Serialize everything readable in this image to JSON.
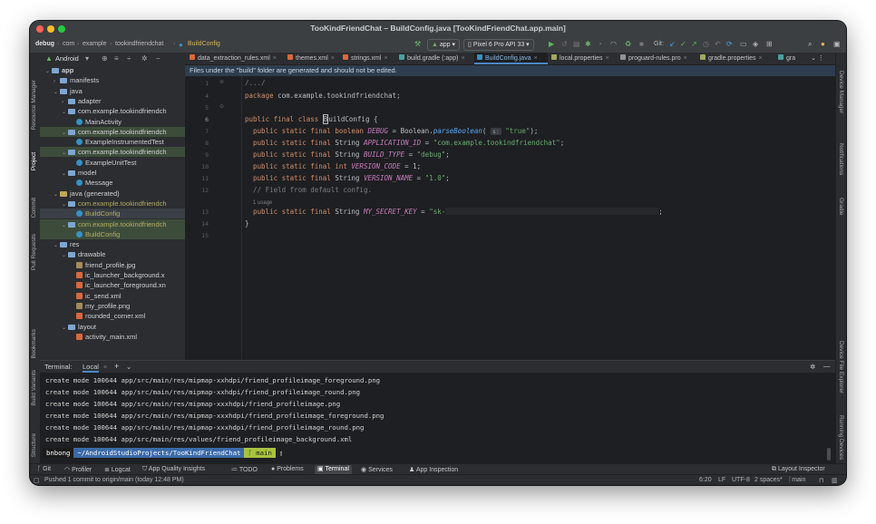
{
  "window": {
    "title": "TooKindFriendChat – BuildConfig.java [TooKindFriendChat.app.main]"
  },
  "toolbar": {
    "breadcrumb": [
      "debug",
      "com",
      "example",
      "tookindfriendchat",
      "BuildConfig"
    ],
    "run_config": "app",
    "device": "Pixel 6 Pro API 33",
    "git_label": "Git:"
  },
  "left_tools": [
    "Resource Manager",
    "Project",
    "Commit",
    "Pull Requests",
    "Bookmarks",
    "Build Variants",
    "Structure"
  ],
  "right_tools": [
    "Device Manager",
    "Notifications",
    "Gradle",
    "Device File Explorer",
    "Running Devices"
  ],
  "project": {
    "view": "Android",
    "tree": [
      {
        "label": "app",
        "level": 0,
        "kind": "module",
        "expanded": true
      },
      {
        "label": "manifests",
        "level": 1,
        "kind": "folder",
        "expanded": false
      },
      {
        "label": "java",
        "level": 1,
        "kind": "folder",
        "expanded": true
      },
      {
        "label": "adapter",
        "level": 2,
        "kind": "folder",
        "expanded": false
      },
      {
        "label": "com.example.tookindfriendch",
        "level": 2,
        "kind": "folder",
        "expanded": true
      },
      {
        "label": "MainActivity",
        "level": 3,
        "kind": "class"
      },
      {
        "label": "com.example.tookindfriendch",
        "level": 2,
        "kind": "folder",
        "expanded": true,
        "highlight": true
      },
      {
        "label": "ExampleInstrumentedTest",
        "level": 3,
        "kind": "class"
      },
      {
        "label": "com.example.tookindfriendch",
        "level": 2,
        "kind": "folder",
        "expanded": true,
        "highlight": true
      },
      {
        "label": "ExampleUnitTest",
        "level": 3,
        "kind": "class"
      },
      {
        "label": "model",
        "level": 2,
        "kind": "folder",
        "expanded": true
      },
      {
        "label": "Message",
        "level": 3,
        "kind": "class"
      },
      {
        "label": "java (generated)",
        "level": 1,
        "kind": "genfolder",
        "expanded": true
      },
      {
        "label": "com.example.tookindfriendch",
        "level": 2,
        "kind": "folder",
        "expanded": true,
        "generated": true
      },
      {
        "label": "BuildConfig",
        "level": 3,
        "kind": "class",
        "generated": true,
        "selected": true
      },
      {
        "label": "com.example.tookindfriendch",
        "level": 2,
        "kind": "folder",
        "expanded": true,
        "generated": true,
        "highlight": true
      },
      {
        "label": "BuildConfig",
        "level": 3,
        "kind": "class",
        "generated": true,
        "highlight": true
      },
      {
        "label": "res",
        "level": 1,
        "kind": "folder",
        "expanded": true
      },
      {
        "label": "drawable",
        "level": 2,
        "kind": "folder",
        "expanded": true
      },
      {
        "label": "friend_profile.jpg",
        "level": 3,
        "kind": "img"
      },
      {
        "label": "ic_launcher_background.x",
        "level": 3,
        "kind": "xml"
      },
      {
        "label": "ic_launcher_foreground.xn",
        "level": 3,
        "kind": "xml"
      },
      {
        "label": "ic_send.xml",
        "level": 3,
        "kind": "xml"
      },
      {
        "label": "my_profile.png",
        "level": 3,
        "kind": "img"
      },
      {
        "label": "rounded_corner.xml",
        "level": 3,
        "kind": "xml"
      },
      {
        "label": "layout",
        "level": 2,
        "kind": "folder",
        "expanded": true
      },
      {
        "label": "activity_main.xml",
        "level": 3,
        "kind": "xml"
      }
    ]
  },
  "editor": {
    "tabs": [
      {
        "label": "data_extraction_rules.xml",
        "color": "#d9683d"
      },
      {
        "label": "themes.xml",
        "color": "#d9683d"
      },
      {
        "label": "strings.xml",
        "color": "#d9683d"
      },
      {
        "label": "build.gradle (:app)",
        "color": "#4aa0a0"
      },
      {
        "label": "BuildConfig.java",
        "color": "#3592c4",
        "active": true
      },
      {
        "label": "local.properties",
        "color": "#a1a860"
      },
      {
        "label": "proguard-rules.pro",
        "color": "#8f9498"
      },
      {
        "label": "gradle.properties",
        "color": "#a1a860"
      },
      {
        "label": "gra",
        "color": "#4aa0a0"
      }
    ],
    "banner": "Files under the \"build\" folder are generated and should not be edited.",
    "line_numbers": [
      "1",
      "4",
      "5",
      "6",
      "7",
      "8",
      "9",
      "10",
      "11",
      "12",
      "13",
      "14",
      "15"
    ],
    "lines": {
      "l1": "/.../",
      "l4_kw": "package",
      "l4_rest": " com.example.tookindfriendchat;",
      "l6_kw": "public final class",
      "l6_cursor": "B",
      "l6_rest": "uildConfig {",
      "l7_kw": "public static final boolean",
      "l7_const": "DEBUG",
      "l7_mid": " = Boolean.",
      "l7_fn": "parseBoolean",
      "l7_paren": "( ",
      "l7_param": "s:",
      "l7_str": " \"true\"",
      "l7_end": ");",
      "l8_kw": "public static final",
      "l8_type": " String ",
      "l8_const": "APPLICATION_ID",
      "l8_eq": " = ",
      "l8_str": "\"com.example.tookindfriendchat\"",
      "l8_end": ";",
      "l9_kw": "public static final",
      "l9_type": " String ",
      "l9_const": "BUILD_TYPE",
      "l9_eq": " = ",
      "l9_str": "\"debug\"",
      "l9_end": ";",
      "l10_kw": "public static final int",
      "l10_const": " VERSION_CODE",
      "l10_end": " = 1;",
      "l11_kw": "public static final",
      "l11_type": " String ",
      "l11_const": "VERSION_NAME",
      "l11_eq": " = ",
      "l11_str": "\"1.0\"",
      "l11_end": ";",
      "l12": "// Field from default config.",
      "usage": "1 usage",
      "l13_kw": "public static final",
      "l13_type": " String ",
      "l13_const": "MY_SECRET_KEY",
      "l13_eq": " = ",
      "l13_str": "\"sk-",
      "l13_end": ";",
      "l14": "}"
    }
  },
  "terminal": {
    "title": "Terminal:",
    "tab": "Local",
    "lines": [
      "create mode 100644 app/src/main/res/mipmap-xxhdpi/friend_profileimage_foreground.png",
      "create mode 100644 app/src/main/res/mipmap-xxhdpi/friend_profileimage_round.png",
      "create mode 100644 app/src/main/res/mipmap-xxxhdpi/friend_profileimage.png",
      "create mode 100644 app/src/main/res/mipmap-xxxhdpi/friend_profileimage_foreground.png",
      "create mode 100644 app/src/main/res/mipmap-xxxhdpi/friend_profileimage_round.png",
      "create mode 100644 app/src/main/res/values/friend_profileimage_background.xml"
    ],
    "prompt_user": "bnbong",
    "prompt_path": "~/AndroidStudioProjects/TooKindFriendChat",
    "prompt_branch": "main"
  },
  "tool_windows": [
    "Git",
    "Profiler",
    "Logcat",
    "App Quality Insights",
    "TODO",
    "Problems",
    "Terminal",
    "Services",
    "App Inspection"
  ],
  "layout_inspector": "Layout Inspector",
  "status": {
    "message": "Pushed 1 commit to origin/main (today 12:48 PM)",
    "position": "6:20",
    "line_sep": "LF",
    "encoding": "UTF-8",
    "indent": "2 spaces*",
    "branch": "main"
  },
  "colors": {
    "accent": "#4a88c7",
    "keyword": "#cf8e6d",
    "string": "#6aab73",
    "constant": "#c77dbb"
  }
}
